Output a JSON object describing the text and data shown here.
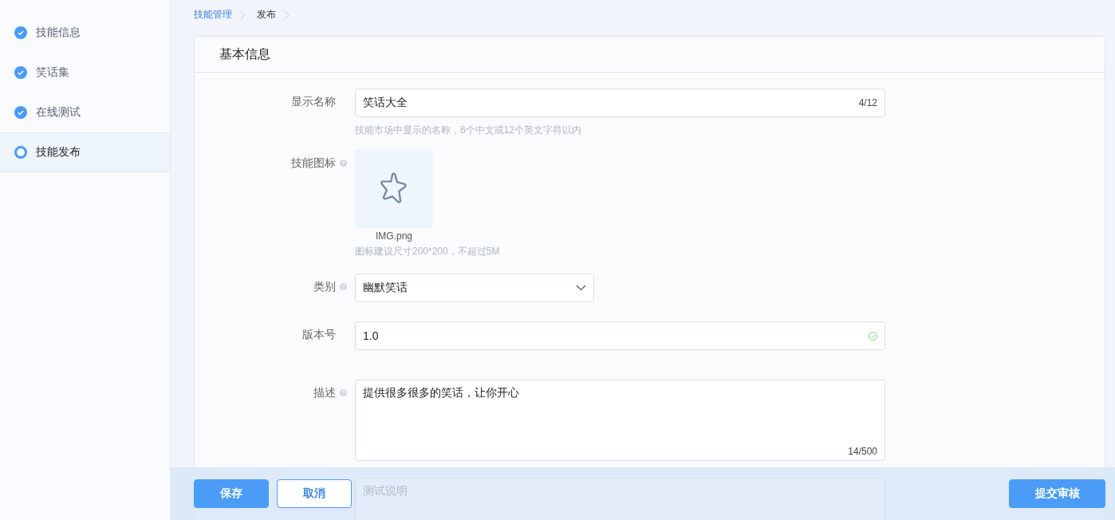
{
  "sidebar": {
    "steps": [
      {
        "label": "技能信息",
        "completed": true,
        "selected": false
      },
      {
        "label": "笑话集",
        "completed": true,
        "selected": false
      },
      {
        "label": "在线测试",
        "completed": true,
        "selected": false
      },
      {
        "label": "技能发布",
        "completed": false,
        "selected": true
      }
    ]
  },
  "breadcrumb": [
    {
      "label": "技能管理",
      "kind": "link"
    },
    {
      "label": "发布",
      "kind": "current"
    }
  ],
  "card": {
    "title": "基本信息",
    "fields": [
      {
        "kind": "text",
        "label": "显示名称",
        "help_icon": false,
        "value": "笑话大全",
        "counter": "4/12",
        "hint": "技能市场中显示的名称，6个中文或12个英文字符以内"
      },
      {
        "kind": "image",
        "label": "技能图标",
        "help_icon": true,
        "file_name": "IMG.png",
        "hint": "图标建议尺寸200*200，不超过5M"
      },
      {
        "kind": "select",
        "label": "类别",
        "help_icon": true,
        "value": "幽默笑话"
      },
      {
        "kind": "text",
        "label": "版本号",
        "help_icon": false,
        "value": "1.0",
        "valid": true
      },
      {
        "kind": "textarea",
        "label": "描述",
        "help_icon": true,
        "value": "提供很多很多的笑话，让你开心",
        "counter": "14/500"
      },
      {
        "kind": "textarea",
        "placeholder": "测试说明"
      }
    ]
  },
  "footer": {
    "buttons": [
      {
        "label": "保存",
        "kind": "primary"
      },
      {
        "label": "取消",
        "kind": "secondary"
      },
      {
        "label": "提交审核",
        "kind": "submit"
      }
    ]
  }
}
